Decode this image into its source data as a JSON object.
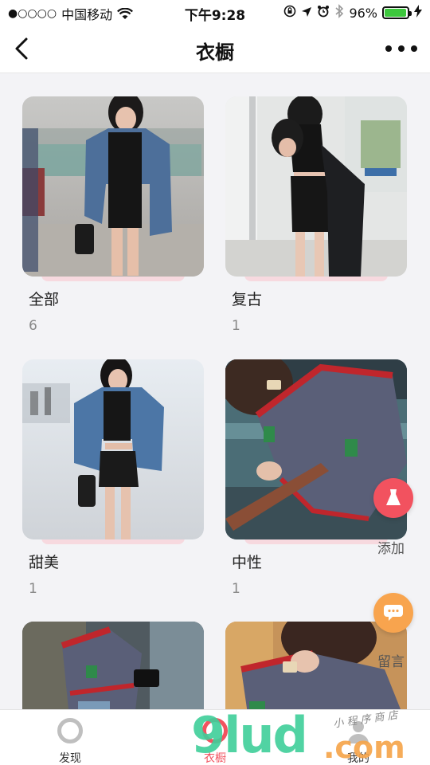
{
  "status_bar": {
    "signal": "●○○○○",
    "carrier": "中国移动",
    "time": "下午9:28",
    "battery_percent": "96%",
    "battery_level": 0.96,
    "icons": [
      "wifi-icon",
      "rotation-lock-icon",
      "location-icon",
      "alarm-icon",
      "bluetooth-icon",
      "battery-icon",
      "charging-icon"
    ]
  },
  "nav": {
    "title": "衣橱",
    "back_icon": "chevron-left-icon",
    "more_icon": "more-dots-icon"
  },
  "categories": [
    {
      "name": "全部",
      "count": "6"
    },
    {
      "name": "复古",
      "count": "1"
    },
    {
      "name": "甜美",
      "count": "1"
    },
    {
      "name": "中性",
      "count": "1"
    },
    {
      "name": "",
      "count": ""
    },
    {
      "name": "",
      "count": ""
    }
  ],
  "floating": {
    "add_label": "添加",
    "message_label": "留言",
    "add_icon": "dress-icon",
    "message_icon": "chat-bubble-icon"
  },
  "tabs": [
    {
      "label": "发现",
      "icon": "ring-icon",
      "active": false
    },
    {
      "label": "衣橱",
      "icon": "ring-icon",
      "active": true
    },
    {
      "label": "我的",
      "icon": "person-icon",
      "active": false
    }
  ],
  "watermark": {
    "main": "9lud",
    "domain": ".com",
    "sub": "小 程 序 商 店"
  },
  "colors": {
    "accent": "#f2525f",
    "orange": "#f8a44e",
    "ribbon": "#f7d9df",
    "background": "#f3f3f6"
  }
}
